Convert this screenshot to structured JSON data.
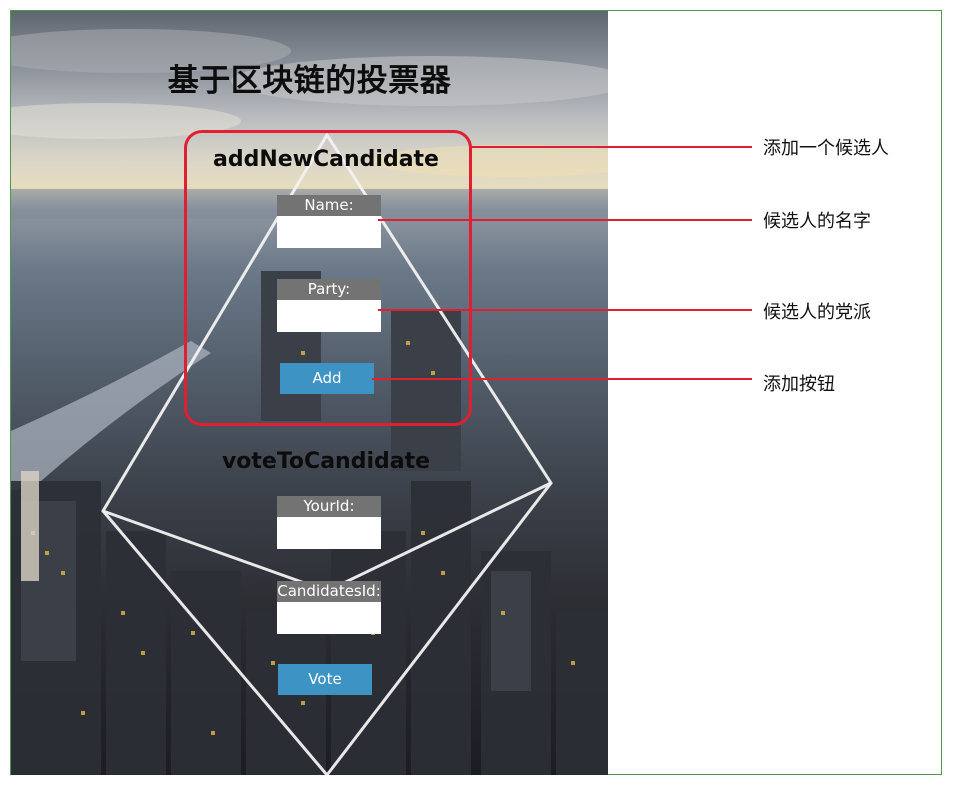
{
  "app": {
    "title": "基于区块链的投票器",
    "add_section": {
      "heading": "addNewCandidate",
      "name_label": "Name:",
      "name_value": "",
      "party_label": "Party:",
      "party_value": "",
      "add_button": "Add"
    },
    "vote_section": {
      "heading": "voteToCandidate",
      "yourid_label": "YourId:",
      "yourid_value": "",
      "candidatesid_label": "CandidatesId:",
      "candidatesid_value": "",
      "vote_button": "Vote"
    }
  },
  "annotations": [
    {
      "text": "添加一个候选人"
    },
    {
      "text": "候选人的名字"
    },
    {
      "text": "候选人的党派"
    },
    {
      "text": "添加按钮"
    }
  ],
  "colors": {
    "annotation_red": "#e02030",
    "button_blue": "#3d93c4",
    "label_gray": "#737373",
    "frame_green": "#4a9a4a"
  }
}
